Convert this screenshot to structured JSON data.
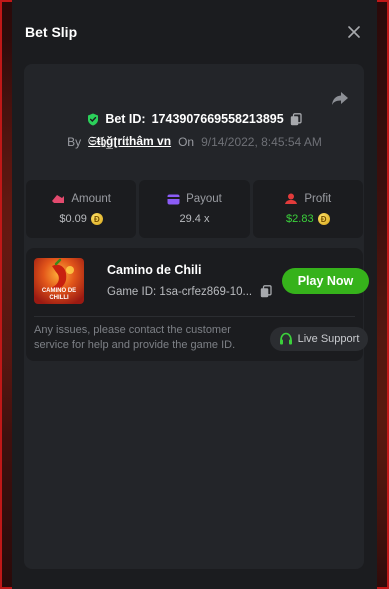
{
  "modal": {
    "title": "Bet Slip"
  },
  "bet": {
    "id_label": "Bet ID:",
    "id_value": "1743907669558213895",
    "by_label": "By",
    "username": "𝔖ŧ𝔥̱ğ̲ʈrί𝔱hâm v̲n",
    "on_label": "On",
    "datetime": "9/14/2022, 8:45:54 AM"
  },
  "stats": {
    "amount": {
      "label": "Amount",
      "value": "$0.09"
    },
    "payout": {
      "label": "Payout",
      "value": "29.4 x"
    },
    "profit": {
      "label": "Profit",
      "value": "$2.83"
    }
  },
  "game": {
    "name": "Camino de Chili",
    "thumb_text": "CAMINO DE CHILLI",
    "id_label": "Game ID:",
    "id_value": "1sa-crfez869-10...",
    "play_label": "Play Now"
  },
  "support": {
    "text": "Any issues, please contact the customer service for help and provide the game ID.",
    "button_label": "Live Support"
  },
  "colors": {
    "accent_green": "#36b21b",
    "profit_green": "#3bd13b",
    "shield_green": "#2bd05a",
    "amount_pink": "#e24a6e",
    "payout_purple": "#8b5cf6",
    "profit_red": "#e23b3b"
  },
  "icons": [
    "close-icon",
    "share-icon",
    "shield-check-icon",
    "copy-icon",
    "amount-icon",
    "payout-icon",
    "profit-icon",
    "coin-icon",
    "headset-icon"
  ]
}
